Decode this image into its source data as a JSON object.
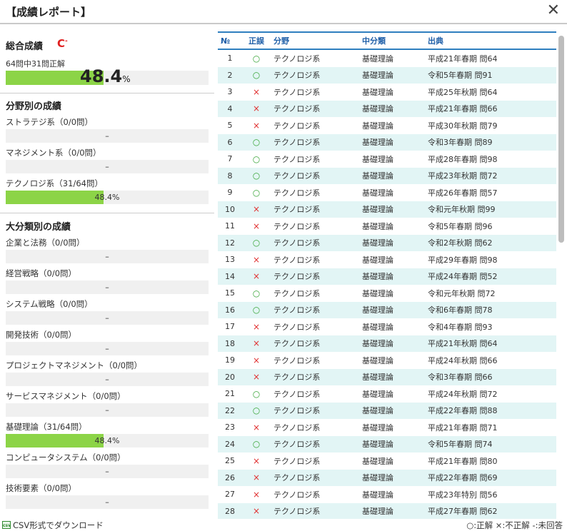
{
  "title": "【成績レポート】",
  "close_label": "✕",
  "overall": {
    "heading": "総合成績",
    "grade": "C",
    "grade_mark": "-",
    "summary": "64問中31問正解",
    "percent": "48.4",
    "percent_unit": "%",
    "fraction": 0.484
  },
  "field": {
    "heading": "分野別の成績",
    "items": [
      {
        "label": "ストラテジ系（0/0問）",
        "value": "–",
        "fraction": 0
      },
      {
        "label": "マネジメント系（0/0問）",
        "value": "–",
        "fraction": 0
      },
      {
        "label": "テクノロジ系（31/64問）",
        "value": "48.4%",
        "fraction": 0.484
      }
    ]
  },
  "major": {
    "heading": "大分類別の成績",
    "items": [
      {
        "label": "企業と法務（0/0問）",
        "value": "–",
        "fraction": 0
      },
      {
        "label": "経営戦略（0/0問）",
        "value": "–",
        "fraction": 0
      },
      {
        "label": "システム戦略（0/0問）",
        "value": "–",
        "fraction": 0
      },
      {
        "label": "開発技術（0/0問）",
        "value": "–",
        "fraction": 0
      },
      {
        "label": "プロジェクトマネジメント（0/0問）",
        "value": "–",
        "fraction": 0
      },
      {
        "label": "サービスマネジメント（0/0問）",
        "value": "–",
        "fraction": 0
      },
      {
        "label": "基礎理論（31/64問）",
        "value": "48.4%",
        "fraction": 0.484
      },
      {
        "label": "コンピュータシステム（0/0問）",
        "value": "–",
        "fraction": 0
      },
      {
        "label": "技術要素（0/0問）",
        "value": "–",
        "fraction": 0
      }
    ]
  },
  "table": {
    "headers": [
      "№",
      "正誤",
      "分野",
      "中分類",
      "出典"
    ],
    "rows": [
      [
        "1",
        "○",
        "テクノロジ系",
        "基礎理論",
        "平成21年春期 問64"
      ],
      [
        "2",
        "○",
        "テクノロジ系",
        "基礎理論",
        "令和5年春期 問91"
      ],
      [
        "3",
        "×",
        "テクノロジ系",
        "基礎理論",
        "平成25年秋期 問64"
      ],
      [
        "4",
        "×",
        "テクノロジ系",
        "基礎理論",
        "平成21年春期 問66"
      ],
      [
        "5",
        "×",
        "テクノロジ系",
        "基礎理論",
        "平成30年秋期 問79"
      ],
      [
        "6",
        "○",
        "テクノロジ系",
        "基礎理論",
        "令和3年春期 問89"
      ],
      [
        "7",
        "○",
        "テクノロジ系",
        "基礎理論",
        "平成28年春期 問98"
      ],
      [
        "8",
        "○",
        "テクノロジ系",
        "基礎理論",
        "平成23年秋期 問72"
      ],
      [
        "9",
        "○",
        "テクノロジ系",
        "基礎理論",
        "平成26年春期 問57"
      ],
      [
        "10",
        "×",
        "テクノロジ系",
        "基礎理論",
        "令和元年秋期 問99"
      ],
      [
        "11",
        "×",
        "テクノロジ系",
        "基礎理論",
        "令和5年春期 問96"
      ],
      [
        "12",
        "○",
        "テクノロジ系",
        "基礎理論",
        "令和2年秋期 問62"
      ],
      [
        "13",
        "×",
        "テクノロジ系",
        "基礎理論",
        "平成29年春期 問98"
      ],
      [
        "14",
        "×",
        "テクノロジ系",
        "基礎理論",
        "平成24年春期 問52"
      ],
      [
        "15",
        "○",
        "テクノロジ系",
        "基礎理論",
        "令和元年秋期 問72"
      ],
      [
        "16",
        "○",
        "テクノロジ系",
        "基礎理論",
        "令和6年春期 問78"
      ],
      [
        "17",
        "×",
        "テクノロジ系",
        "基礎理論",
        "令和4年春期 問93"
      ],
      [
        "18",
        "×",
        "テクノロジ系",
        "基礎理論",
        "平成21年秋期 問64"
      ],
      [
        "19",
        "×",
        "テクノロジ系",
        "基礎理論",
        "平成24年秋期 問66"
      ],
      [
        "20",
        "×",
        "テクノロジ系",
        "基礎理論",
        "令和3年春期 問66"
      ],
      [
        "21",
        "○",
        "テクノロジ系",
        "基礎理論",
        "平成24年秋期 問72"
      ],
      [
        "22",
        "○",
        "テクノロジ系",
        "基礎理論",
        "平成22年春期 問88"
      ],
      [
        "23",
        "×",
        "テクノロジ系",
        "基礎理論",
        "平成21年春期 問71"
      ],
      [
        "24",
        "○",
        "テクノロジ系",
        "基礎理論",
        "令和5年春期 問74"
      ],
      [
        "25",
        "×",
        "テクノロジ系",
        "基礎理論",
        "平成21年春期 問80"
      ],
      [
        "26",
        "×",
        "テクノロジ系",
        "基礎理論",
        "平成22年春期 問69"
      ],
      [
        "27",
        "×",
        "テクノロジ系",
        "基礎理論",
        "平成23年特別 問56"
      ],
      [
        "28",
        "×",
        "テクノロジ系",
        "基礎理論",
        "平成27年春期 問62"
      ]
    ]
  },
  "footer": {
    "csv_icon": "csv",
    "csv_label": "CSV形式でダウンロード",
    "legend": "○:正解 ×:不正解 -:未回答"
  },
  "colors": {
    "bar_fill": "#8cd447",
    "correct": "#3aa63a",
    "incorrect": "#e03030",
    "header": "#1f5fa8"
  }
}
